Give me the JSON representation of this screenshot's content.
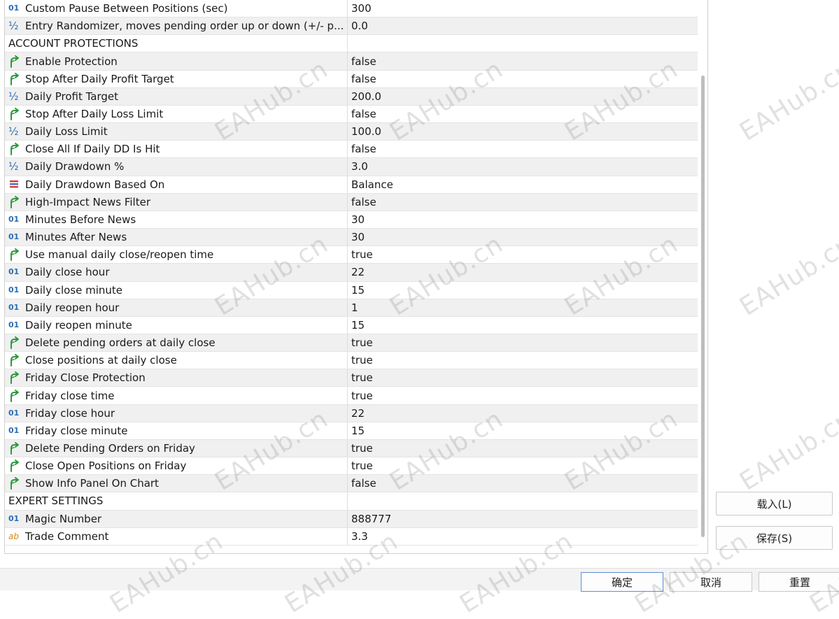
{
  "rows": [
    {
      "type": "int",
      "name": "Custom Pause Between Positions (sec)",
      "value": "300"
    },
    {
      "type": "dbl",
      "name": "Entry Randomizer, moves pending order up or down (+/- p...",
      "value": "0.0"
    },
    {
      "type": "section",
      "name": "ACCOUNT PROTECTIONS",
      "value": ""
    },
    {
      "type": "bool",
      "name": "Enable Protection",
      "value": "false"
    },
    {
      "type": "bool",
      "name": "Stop After Daily Profit Target",
      "value": "false"
    },
    {
      "type": "dbl",
      "name": "Daily Profit Target",
      "value": "200.0"
    },
    {
      "type": "bool",
      "name": "Stop After Daily Loss Limit",
      "value": "false"
    },
    {
      "type": "dbl",
      "name": "Daily Loss Limit",
      "value": "100.0"
    },
    {
      "type": "bool",
      "name": "Close All If Daily DD Is Hit",
      "value": "false"
    },
    {
      "type": "dbl",
      "name": "Daily Drawdown %",
      "value": "3.0"
    },
    {
      "type": "enum",
      "name": "Daily Drawdown Based On",
      "value": "Balance"
    },
    {
      "type": "bool",
      "name": "High-Impact News Filter",
      "value": "false"
    },
    {
      "type": "int",
      "name": "Minutes Before News",
      "value": "30"
    },
    {
      "type": "int",
      "name": "Minutes After News",
      "value": "30"
    },
    {
      "type": "bool",
      "name": "Use manual daily close/reopen time",
      "value": "true"
    },
    {
      "type": "int",
      "name": "Daily close hour",
      "value": "22"
    },
    {
      "type": "int",
      "name": "Daily close minute",
      "value": "15"
    },
    {
      "type": "int",
      "name": "Daily reopen hour",
      "value": "1"
    },
    {
      "type": "int",
      "name": "Daily reopen minute",
      "value": "15"
    },
    {
      "type": "bool",
      "name": "Delete pending orders at daily close",
      "value": "true"
    },
    {
      "type": "bool",
      "name": "Close positions at daily close",
      "value": "true"
    },
    {
      "type": "bool",
      "name": "Friday Close Protection",
      "value": "true"
    },
    {
      "type": "bool",
      "name": "Friday close time",
      "value": "true"
    },
    {
      "type": "int",
      "name": "Friday close hour",
      "value": "22"
    },
    {
      "type": "int",
      "name": "Friday close minute",
      "value": "15"
    },
    {
      "type": "bool",
      "name": "Delete Pending Orders on Friday",
      "value": "true"
    },
    {
      "type": "bool",
      "name": "Close Open Positions on Friday",
      "value": "true"
    },
    {
      "type": "bool",
      "name": "Show Info Panel On Chart",
      "value": "false"
    },
    {
      "type": "section",
      "name": "EXPERT SETTINGS",
      "value": ""
    },
    {
      "type": "int",
      "name": "Magic Number",
      "value": "888777"
    },
    {
      "type": "str",
      "name": "Trade Comment",
      "value": "3.3"
    }
  ],
  "icons": {
    "int": {
      "glyph": "01",
      "name": "integer-type-icon",
      "color": "#2a6db5"
    },
    "dbl": {
      "glyph": "½",
      "name": "double-type-icon",
      "color": "#2a6db5"
    },
    "bool": {
      "glyph": "",
      "name": "boolean-type-icon",
      "color": "#2c9a3c"
    },
    "enum": {
      "glyph": "",
      "name": "enum-type-icon",
      "color": "#d23b3b"
    },
    "str": {
      "glyph": "ab",
      "name": "string-type-icon",
      "color": "#d98b1a"
    }
  },
  "buttons": {
    "load": "载入(L)",
    "save": "保存(S)",
    "ok": "确定",
    "cancel": "取消",
    "reset": "重置"
  },
  "watermark": "EAHub.cn"
}
